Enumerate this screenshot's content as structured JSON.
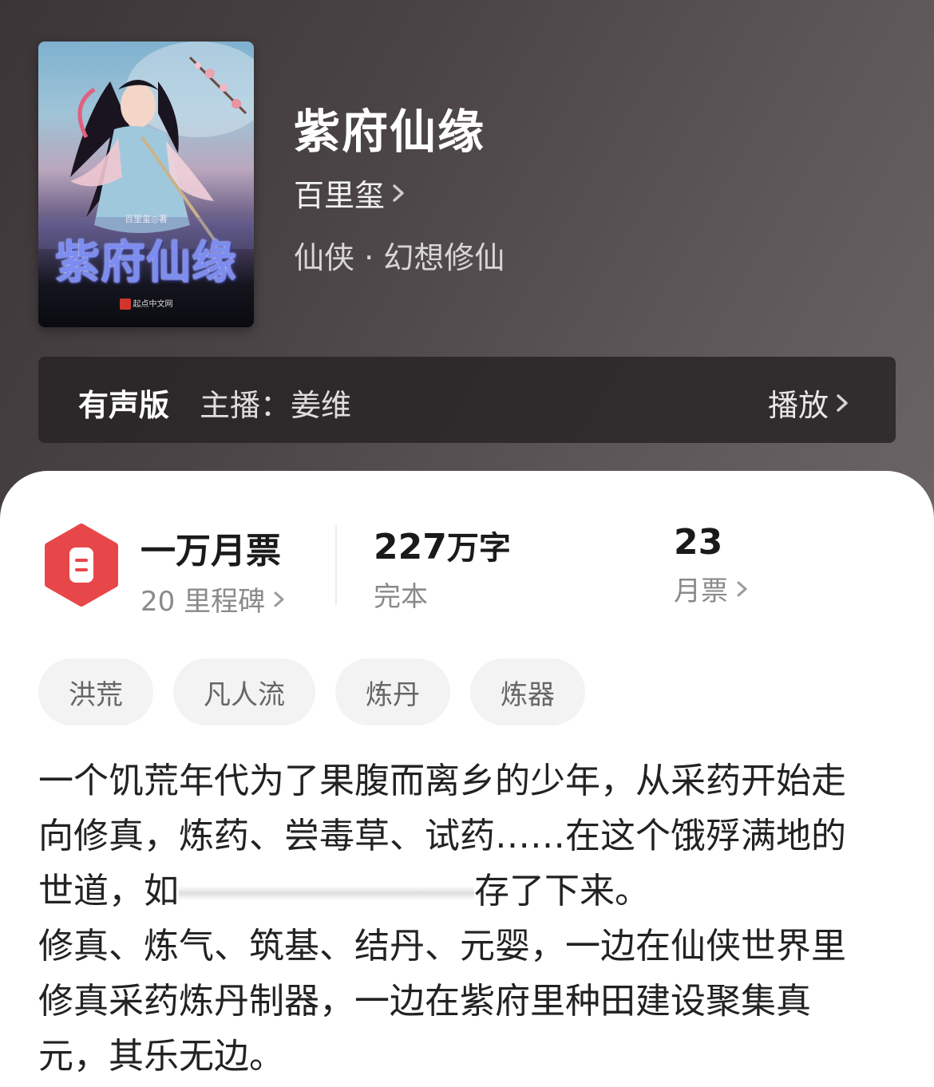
{
  "book": {
    "title": "紫府仙缘",
    "author": "百里玺",
    "genre": "仙侠 · 幻想修仙",
    "cover": {
      "author_line": "百里玺◎著",
      "title": "紫府仙缘",
      "publisher": "起点中文网",
      "publisher_icon": "起"
    }
  },
  "audio": {
    "label": "有声版",
    "host": "主播：姜维",
    "play_label": "播放"
  },
  "stats": {
    "tickets_title": "一万月票",
    "milestones": "20 里程碑",
    "word_count_number": "227",
    "word_count_unit": "万字",
    "status": "完本",
    "monthly_tickets_number": "23",
    "monthly_tickets_label": "月票"
  },
  "tags": [
    "洪荒",
    "凡人流",
    "炼丹",
    "炼器"
  ],
  "description": {
    "line1": "一个饥荒年代为了果腹而离乡的少年，从采药开始走",
    "line2": "向修真，炼药、尝毒草、试药……在这个饿殍满地的",
    "line3_start": "世道，如",
    "line3_end": "存了下来。",
    "line4": "修真、炼气、筑基、结丹、元婴，一边在仙侠世界里",
    "line5": "修真采药炼丹制器，一边在紫府里种田建设聚集真",
    "line6": "元，其乐无边。"
  },
  "colors": {
    "badge_red": "#e8474a",
    "hero_dark": "#3b3537"
  },
  "icons": [
    "chevron-right-icon",
    "monthly-ticket-badge-icon"
  ]
}
